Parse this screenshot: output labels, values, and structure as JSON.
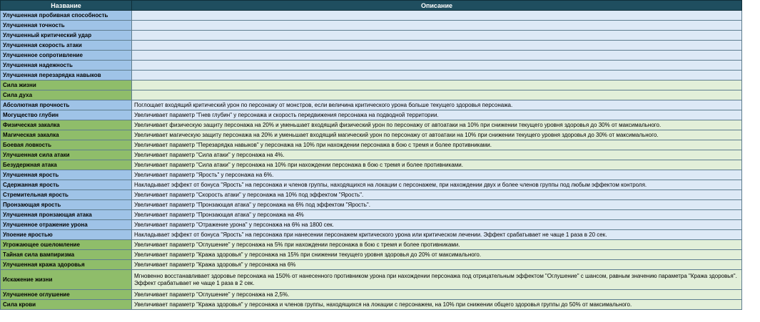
{
  "header": {
    "name": "Название",
    "description": "Описание"
  },
  "rows": [
    {
      "name": "Улучшенная пробивная способность",
      "desc": "",
      "group": "blue"
    },
    {
      "name": "Улучшенная точность",
      "desc": "",
      "group": "blue"
    },
    {
      "name": "Улучшенный критический удар",
      "desc": "",
      "group": "blue"
    },
    {
      "name": "Улучшенная скорость атаки",
      "desc": "",
      "group": "blue"
    },
    {
      "name": "Улучшенное сопротивление",
      "desc": "",
      "group": "blue"
    },
    {
      "name": "Улучшенная надежность",
      "desc": "",
      "group": "blue"
    },
    {
      "name": "Улучшенная перезарядка навыков",
      "desc": "",
      "group": "blue"
    },
    {
      "name": "Сила жизни",
      "desc": "",
      "group": "green"
    },
    {
      "name": "Сила духа",
      "desc": "",
      "group": "green"
    },
    {
      "name": "Абсолютная прочность",
      "desc": "Поглощает входящий критический урон по персонажу от монстров, если величина критического урона больше текущего здоровья персонажа.",
      "group": "blue"
    },
    {
      "name": "Могущество глубин",
      "desc": "Увеличивает параметр \"Гнев глубин\" у персонажа и скорость передвижения персонажа на подводной территории.",
      "group": "blue"
    },
    {
      "name": "Физическая закалка",
      "desc": "Увеличивает физическую защиту персонажа на 20% и уменьшает входящий физический урон по персонажу от автоатаки на 10% при снижении текущего уровня здоровья до 30% от максимального.",
      "group": "green"
    },
    {
      "name": "Магическая закалка",
      "desc": "Увеличивает магическую защиту персонажа на 20% и уменьшает входящий магический урон по персонажу от автоатаки на 10% при снижении текущего уровня здоровья до 30% от максимального.",
      "group": "green"
    },
    {
      "name": "Боевая ловкость",
      "desc": "Увеличивает параметр \"Перезарядка навыков\" у персонажа на 10% при нахождении персонажа в бою с тремя и более противниками.",
      "group": "green"
    },
    {
      "name": "Улучшенная сила атаки",
      "desc": "Увеличивает параметр \"Сила атаки\" у персонажа на 4%.",
      "group": "green"
    },
    {
      "name": "Безудержная атака",
      "desc": "Увеличивает параметр \"Сила атаки\" у персонажа на 10% при нахождении персонажа в бою с тремя и более противниками.",
      "group": "green"
    },
    {
      "name": "Улучшенная ярость",
      "desc": "Увеличивает параметр \"Ярость\" у персонажа на 6%.",
      "group": "blue"
    },
    {
      "name": "Сдержанная ярость",
      "desc": "Накладывает эффект от бонуса \"Ярость\" на персонажа и членов группы, находящихся на локации с персонажем, при нахождении двух и более членов группы под любым эффектом контроля.",
      "group": "blue"
    },
    {
      "name": "Стремительная ярость",
      "desc": "Увеличивает параметр \"Скорость атаки\" у персонажа на 10% под эффектом \"Ярость\".",
      "group": "blue"
    },
    {
      "name": "Пронзающая ярость",
      "desc": "Увеличивает параметр \"Пронзающая атака\" у персонажа на 6% под эффектом \"Ярость\".",
      "group": "blue"
    },
    {
      "name": "Улучшенная пронзающая атака",
      "desc": "Увеличивает параметр \"Пронзающая атака\" у персонажа на 4%",
      "group": "blue"
    },
    {
      "name": "Улучшенное отражение урона",
      "desc": "Увеличивает параметр \"Отражение урона\" у персонажа на 6% на 1800 сек.",
      "group": "blue"
    },
    {
      "name": "Упоение яростью",
      "desc": "Накладывает эффект от бонуса \"Ярость\" на персонажа при нанесении персонажем критического урона или критическом лечении. Эффект срабатывает не чаще 1 раза в 20 сек.",
      "group": "blue"
    },
    {
      "name": "Угрожающее ошеломление",
      "desc": "Увеличивает параметр \"Оглушение\" у персонажа на 5% при нахождении персонажа в бою с тремя и более противниками.",
      "group": "green"
    },
    {
      "name": "Тайная сила вампиризма",
      "desc": "Увеличивает параметр \"Кража здоровья\" у персонажа на 15% при снижении текущего уровня здоровья до 20% от максимального.",
      "group": "green"
    },
    {
      "name": "Улучшенная кража здоровья",
      "desc": "Увеличивает параметр \"Кража здоровья\" у персонажа на 6%",
      "group": "green"
    },
    {
      "name": "Искажение жизни",
      "desc": "Мгновенно восстанавливает здоровье персонажа на 150% от нанесенного противником урона при нахождении персонажа под отрицательным эффектом \"Оглушение\" с шансом, равным значению параметра \"Кража здоровья\". Эффект срабатывает не чаще 1 раза в 2 сек.",
      "group": "green",
      "tall": true
    },
    {
      "name": "Улучшенное оглушение",
      "desc": "Увеличивает параметр \"Оглушение\" у персонажа на 2,5%.",
      "group": "green"
    },
    {
      "name": "Сила крови",
      "desc": "Увеличивает параметр \"Кража здоровья\" у персонажа и членов группы, находящихся на локации с персонажем, на 10% при снижении общего здоровья группы до 50% от максимального.",
      "group": "green"
    }
  ]
}
